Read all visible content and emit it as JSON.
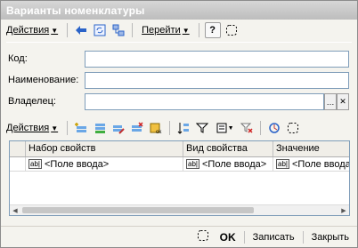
{
  "window": {
    "title": "Варианты номенклатуры"
  },
  "toolbar_main": {
    "actions_label": "Действия",
    "goto_label": "Перейти"
  },
  "form": {
    "code_label": "Код:",
    "name_label": "Наименование:",
    "owner_label": "Владелец:",
    "code_value": "",
    "name_value": "",
    "owner_value": ""
  },
  "toolbar_table": {
    "actions_label": "Действия"
  },
  "table": {
    "columns": [
      "Набор свойств",
      "Вид свойства",
      "Значение"
    ],
    "rows": [
      [
        "<Поле ввода>",
        "<Поле ввода>",
        "<Поле ввода>"
      ]
    ],
    "type_badge": "ab|"
  },
  "footer": {
    "ok_label": "OK",
    "save_label": "Записать",
    "close_label": "Закрыть"
  }
}
